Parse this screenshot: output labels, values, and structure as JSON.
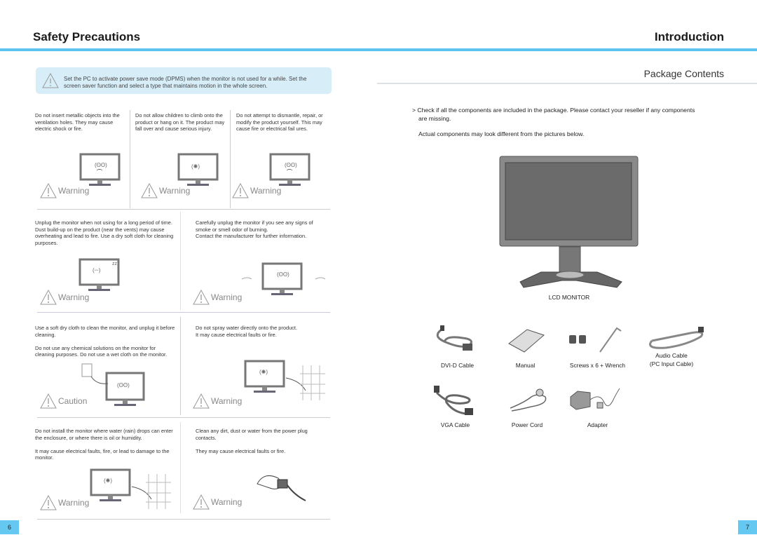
{
  "left_page": {
    "title": "Safety Precautions",
    "dpms_notice": "Set the PC to activate power save mode (DPMS) when the monitor is not used for a while. Set the screen saver function and select a type that maintains motion in the whole screen.",
    "rows": [
      {
        "items": [
          {
            "text": "Do not insert metallic objects into the ventilation holes. They may cause electric shock or fire.",
            "label": "Warning"
          },
          {
            "text": "Do not allow children to climb onto the product or hang on it. The product may fall over and cause serious injury.",
            "label": "Warning"
          },
          {
            "text": "Do not attempt to dismantle, repair, or modify the product yourself. This may cause fire or electrical fail ures.",
            "label": "Warning"
          }
        ]
      },
      {
        "items": [
          {
            "text": "Unplug the monitor when not using for a long period of time.\nDust build-up on the product (near the vents) may cause overheating and lead to fire. Use a dry soft cloth for cleaning purposes.",
            "label": "Warning"
          },
          {
            "text": "Carefully unplug the monitor if you see any signs of smoke or smell odor of burning.\nContact the manufacturer for further information.",
            "label": "Warning"
          }
        ]
      },
      {
        "items": [
          {
            "text": "Use a soft dry cloth to clean the monitor, and unplug it before cleaning.\n\nDo not use any chemical solutions on the monitor for cleaning purposes. Do not use a wet cloth on the monitor.",
            "label": "Caution"
          },
          {
            "text": "Do not spray water directly onto the product.\nIt may cause electrical faults or fire.",
            "label": "Warning"
          }
        ]
      },
      {
        "items": [
          {
            "text": "Do not install the monitor where water (rain) drops can enter the enclosure, or where there is oil or humidity.\n\nIt may cause electrical faults, fire, or lead to damage to the monitor.",
            "label": "Warning"
          },
          {
            "text": "Clean any dirt, dust or water from the power plug contacts.\n\nThey may cause electrical faults or fire.",
            "label": "Warning"
          }
        ]
      }
    ],
    "page_number": "6"
  },
  "right_page": {
    "title": "Introduction",
    "section_title": "Package Contents",
    "intro_line1": "> Check if all the components are included in the package. Please contact your reseller if any components",
    "intro_line2": "are missing.",
    "intro_line3": "Actual components may look different from the pictures below.",
    "main_item": "LCD MONITOR",
    "items_row1": [
      "DVI-D  Cable",
      "Manual",
      "Screws x 6  + Wrench",
      "Audio Cable",
      "(PC Input Cable)"
    ],
    "items_row2": [
      "VGA Cable",
      "Power Cord",
      "Adapter"
    ],
    "page_number": "7"
  },
  "colors": {
    "accent_blue": "#5bc5ef",
    "notice_bg": "#d7eef9"
  }
}
